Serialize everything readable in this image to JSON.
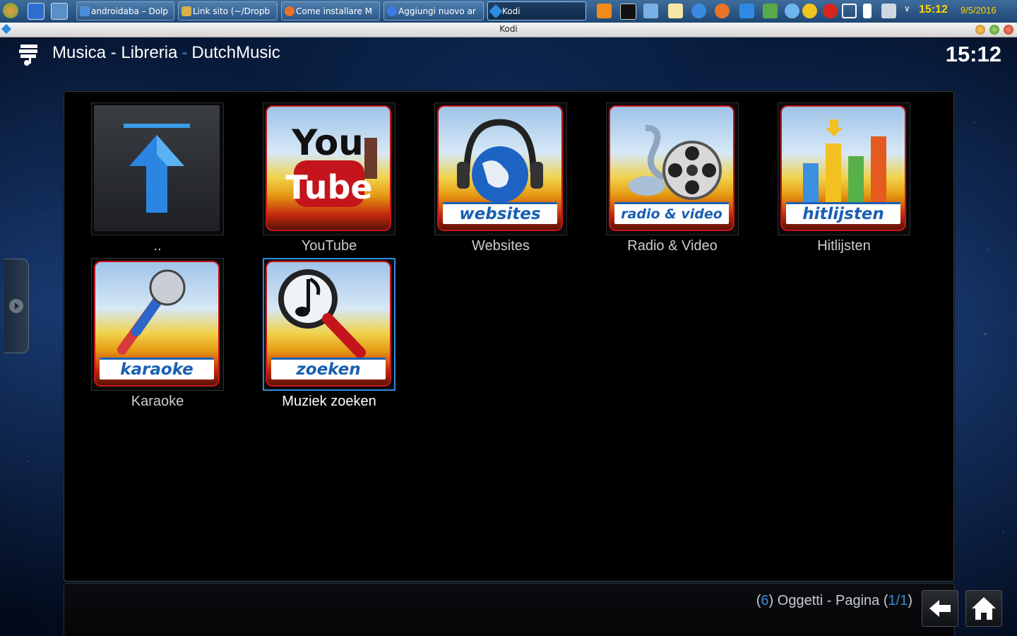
{
  "taskbar": {
    "tasks": [
      {
        "label": "androidaba – Dolp",
        "icon": "dolphin-icon"
      },
      {
        "label": "Link sito (~/Dropb",
        "icon": "editor-icon"
      },
      {
        "label": "Come installare M",
        "icon": "firefox-icon"
      },
      {
        "label": "Aggiungi nuovo ar",
        "icon": "chrome-icon"
      },
      {
        "label": "Kodi",
        "icon": "kodi-icon"
      }
    ],
    "clock": "15:12",
    "date": "9/5/2016"
  },
  "window": {
    "title": "Kodi"
  },
  "kodi": {
    "breadcrumb": {
      "part1": "Musica - Libreria",
      "part2": "DutchMusic"
    },
    "clock": "15:12",
    "items": [
      {
        "label": "..",
        "art": "parent-folder"
      },
      {
        "label": "YouTube",
        "art": "youtube"
      },
      {
        "label": "Websites",
        "art": "websites",
        "band": "websites"
      },
      {
        "label": "Radio & Video",
        "art": "radio-video",
        "band": "radio & video"
      },
      {
        "label": "Hitlijsten",
        "art": "hitlijsten",
        "band": "hitlijsten"
      },
      {
        "label": "Karaoke",
        "art": "karaoke",
        "band": "karaoke"
      },
      {
        "label": "Muziek zoeken",
        "art": "zoeken",
        "band": "zoeken",
        "focused": true
      }
    ],
    "footer": {
      "count": "6",
      "items_text": "Oggetti - Pagina",
      "page": "1/1"
    },
    "colors": {
      "accent": "#3b8bd8",
      "focus": "#2d8ae0"
    }
  }
}
